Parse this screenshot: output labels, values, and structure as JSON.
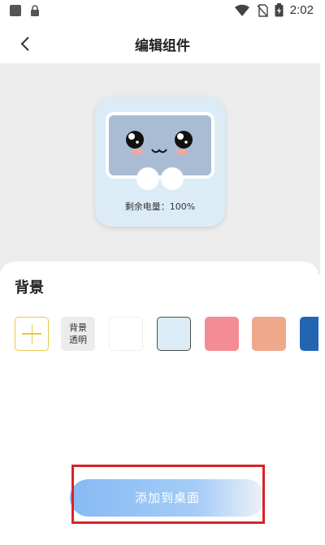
{
  "status_bar": {
    "time": "2:02"
  },
  "header": {
    "title": "编辑组件"
  },
  "widget": {
    "caption": "剩余电量：100%"
  },
  "background_section": {
    "title": "背景",
    "transparent_label_line1": "背景",
    "transparent_label_line2": "透明",
    "swatch_colors": [
      "#ffffff",
      "#dcecf6",
      "#f38d93",
      "#efa88a",
      "#2365b1"
    ]
  },
  "add_button": {
    "label": "添加到桌面"
  },
  "colors": {
    "accent": "#86b9f4",
    "highlight": "#d8232a"
  }
}
